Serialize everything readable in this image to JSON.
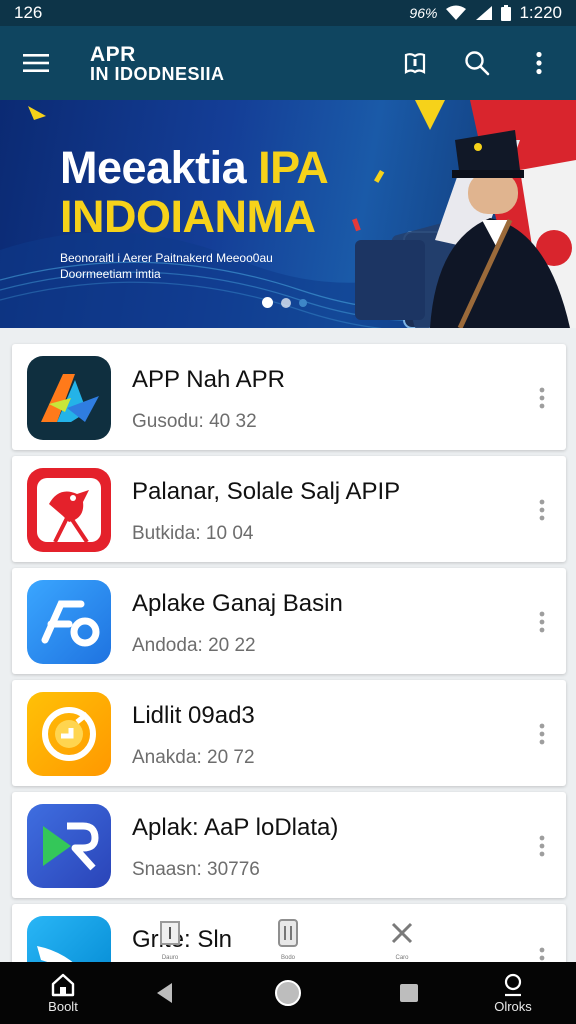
{
  "status_bar": {
    "left_text": "126",
    "battery_text": "96%",
    "time": "1:220",
    "icons": [
      "wifi-icon",
      "signal-icon",
      "battery-icon"
    ]
  },
  "app_bar": {
    "logo_line1": "APR",
    "logo_line2": "IN IDODNESIIA",
    "icons": [
      "menu-icon",
      "book-icon",
      "search-icon",
      "more-vert-icon"
    ]
  },
  "banner": {
    "title_part1": "Meeaktia ",
    "title_part2": "IPA",
    "title_line2": "INDOIANMA",
    "subtitle_line1": "Beonoraitl i Aerer Paitnakerd Meeoo0au",
    "subtitle_line2": "Doormeetiam imtia",
    "slides_total": 3,
    "active_slide": 1,
    "colors": {
      "title": "#ffffff",
      "accent": "#f6d21a",
      "background": "#143e97"
    }
  },
  "apps": [
    {
      "name": "APP Nah APR",
      "meta": "Gusodu: 40 32",
      "icon": "abstract-a-icon",
      "color": "#0f2f3f"
    },
    {
      "name": "Palanar, Solale Salj APIP",
      "meta": "Butkida: 10 04",
      "icon": "bird-flag-icon",
      "color": "#e4212b"
    },
    {
      "name": "Aplake Ganaj Basin",
      "meta": "Andoda: 20 22",
      "icon": "fo-logo-icon",
      "color": "#2d8ff0"
    },
    {
      "name": "Lidlit 09ad3",
      "meta": "Anakda: 20 72",
      "icon": "g-circle-icon",
      "color": "#ffb300"
    },
    {
      "name": "Aplak: AaP loDlata)",
      "meta": "Snaasn: 30776",
      "icon": "play-r-icon",
      "color": "#3a5bd0"
    },
    {
      "name": "Grlte: Sln",
      "meta": "",
      "icon": "swoosh-icon",
      "color": "#1aa3e8"
    }
  ],
  "float_tools": [
    {
      "icon": "ticket-icon",
      "caption": "Dauro"
    },
    {
      "icon": "document-icon",
      "caption": "Bodo"
    },
    {
      "icon": "close-icon",
      "caption": "Caro"
    }
  ],
  "bottom_nav": {
    "home_label": "Boolt",
    "profile_label": "Olroks",
    "icons": [
      "home-icon",
      "back-icon",
      "circle-home-icon",
      "square-recent-icon",
      "person-icon"
    ]
  }
}
